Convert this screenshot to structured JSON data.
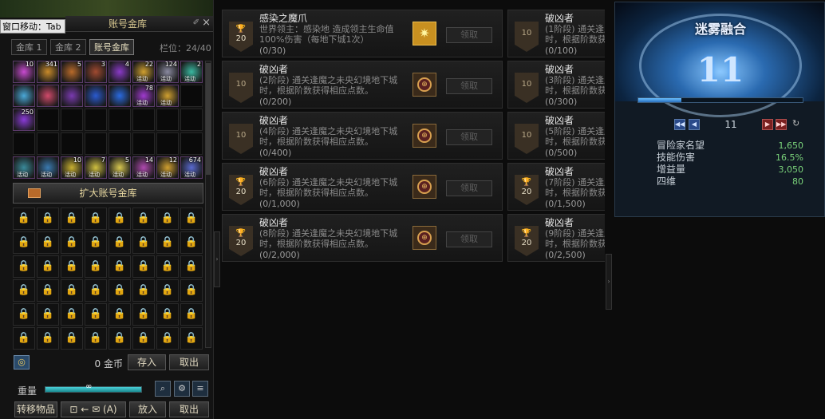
{
  "storage": {
    "window_move": "窗口移动：Tab",
    "title": "账号金库",
    "pin_glyph": "✐",
    "close_glyph": "×",
    "tabs": [
      {
        "label": "金库 1"
      },
      {
        "label": "金库 2"
      },
      {
        "label": "账号金库"
      }
    ],
    "slot_label": "栏位：24/40",
    "items": [
      {
        "qty": "10",
        "tag": "",
        "color": "#c84ad0"
      },
      {
        "qty": "341",
        "tag": "",
        "color": "#c88a2a"
      },
      {
        "qty": "5",
        "tag": "",
        "color": "#b86a2a"
      },
      {
        "qty": "3",
        "tag": "",
        "color": "#a04a30"
      },
      {
        "qty": "4",
        "tag": "",
        "color": "#8a3ac8"
      },
      {
        "qty": "22",
        "tag": "活动",
        "color": "#d0a030"
      },
      {
        "qty": "124",
        "tag": "活动",
        "color": "#8a8aa0"
      },
      {
        "qty": "2",
        "tag": "活动",
        "color": "#3ab8a0"
      },
      {
        "qty": "",
        "tag": "",
        "color": "#4aa8d8"
      },
      {
        "qty": "",
        "tag": "",
        "color": "#d04a6a"
      },
      {
        "qty": "",
        "tag": "",
        "color": "#7a3ab0"
      },
      {
        "qty": "",
        "tag": "",
        "color": "#2a5ad0"
      },
      {
        "qty": "",
        "tag": "",
        "color": "#2a6ae0"
      },
      {
        "qty": "78",
        "tag": "活动",
        "color": "#a03ad0"
      },
      {
        "qty": "",
        "tag": "活动",
        "color": "#d0a030"
      },
      {
        "qty": "250",
        "tag": "",
        "color": "#8a3ad8"
      },
      {
        "qty": "",
        "tag": "活动",
        "color": "#3a8a9a"
      },
      {
        "qty": "",
        "tag": "活动",
        "color": "#3a7ab0"
      },
      {
        "qty": "10",
        "tag": "活动",
        "color": "#c8b030"
      },
      {
        "qty": "7",
        "tag": "活动",
        "color": "#d0c040"
      },
      {
        "qty": "5",
        "tag": "活动",
        "color": "#d8c850"
      },
      {
        "qty": "14",
        "tag": "活动",
        "color": "#b04ab0"
      },
      {
        "qty": "12",
        "tag": "活动",
        "color": "#d0a030"
      },
      {
        "qty": "674",
        "tag": "活动",
        "color": "#5a6ad0"
      }
    ],
    "lock_glyph": "🔒",
    "expand_label": "扩大账号金库",
    "gold_icon_glyph": "◎",
    "gold_text": "0 金币",
    "deposit_label": "存入",
    "withdraw_label": "取出",
    "weight_label": "重量",
    "weight_fill_fraction": 1.0,
    "weight_value": "∞",
    "search_glyph": "⌕",
    "gear_glyph": "⚙",
    "list_glyph": "≡",
    "transfer_label": "转移物品",
    "transfer_arrow_label": "⊡ ← ✉ (A)",
    "put_in_label": "放入",
    "take_out_label": "取出"
  },
  "achievements": [
    {
      "col": 0,
      "row": 0,
      "title": "感染之魔爪",
      "desc": "世界领主：感染地      造成领主生命值100%伤害（每地下城1次）",
      "progress": "(0/30)",
      "points": "20",
      "cup": true,
      "reward": "gold",
      "claim": "领取"
    },
    {
      "col": 1,
      "row": 0,
      "title": "破凶者",
      "desc": "(1阶段) 通关逢魔之未央幻境地下城时，根据阶数获得相应点数。",
      "progress": "(0/100)",
      "points": "10",
      "cup": false,
      "reward": "",
      "claim": ""
    },
    {
      "col": 0,
      "row": 1,
      "title": "破凶者",
      "desc": "(2阶段) 通关逢魔之未央幻境地下城时，根据阶数获得相应点数。",
      "progress": "(0/200)",
      "points": "10",
      "cup": false,
      "reward": "seal",
      "claim": "领取"
    },
    {
      "col": 1,
      "row": 1,
      "title": "破凶者",
      "desc": "(3阶段) 通关逢魔之未央幻境地下城时，根据阶数获得相应点数。",
      "progress": "(0/300)",
      "points": "10",
      "cup": false,
      "reward": "",
      "claim": ""
    },
    {
      "col": 0,
      "row": 2,
      "title": "破凶者",
      "desc": "(4阶段) 通关逢魔之未央幻境地下城时，根据阶数获得相应点数。",
      "progress": "(0/400)",
      "points": "10",
      "cup": false,
      "reward": "seal",
      "claim": "领取"
    },
    {
      "col": 1,
      "row": 2,
      "title": "破凶者",
      "desc": "(5阶段) 通关逢魔之未央幻境地下城时，根据阶数获得相应点数。",
      "progress": "(0/500)",
      "points": "10",
      "cup": false,
      "reward": "",
      "claim": ""
    },
    {
      "col": 0,
      "row": 3,
      "title": "破凶者",
      "desc": "(6阶段) 通关逢魔之未央幻境地下城时，根据阶数获得相应点数。",
      "progress": "(0/1,000)",
      "points": "20",
      "cup": true,
      "reward": "seal",
      "claim": "领取"
    },
    {
      "col": 1,
      "row": 3,
      "title": "破凶者",
      "desc": "(7阶段) 通关逢魔之未央幻境地下城时，根据阶数获得相应点数。",
      "progress": "(0/1,500)",
      "points": "20",
      "cup": true,
      "reward": "",
      "claim": ""
    },
    {
      "col": 0,
      "row": 4,
      "title": "破凶者",
      "desc": "(8阶段) 通关逢魔之未央幻境地下城时，根据阶数获得相应点数。",
      "progress": "(0/2,000)",
      "points": "20",
      "cup": true,
      "reward": "seal",
      "claim": "领取"
    },
    {
      "col": 1,
      "row": 4,
      "title": "破凶者",
      "desc": "(9阶段) 通关逢魔之未央幻境地下城时，根据阶数获得相应点数。",
      "progress": "(0/2,500)",
      "points": "20",
      "cup": true,
      "reward": "",
      "claim": ""
    }
  ],
  "cup_glyph": "🏆",
  "seal_glyph": "⊕",
  "gold_reward_glyph": "✷",
  "handle_glyph": "›",
  "mist": {
    "title": "迷雾融合",
    "level": "11",
    "exp_fraction": 0.26,
    "page": "11",
    "first_glyph": "◀◀",
    "prev_glyph": "◀",
    "next_glyph": "▶",
    "last_glyph": "▶▶",
    "refresh_glyph": "↻",
    "stats": [
      {
        "name": "冒险家名望",
        "value": "1,650"
      },
      {
        "name": "技能伤害",
        "value": "16.5%"
      },
      {
        "name": "增益量",
        "value": "3,050"
      },
      {
        "name": "四维",
        "value": "80"
      }
    ]
  }
}
